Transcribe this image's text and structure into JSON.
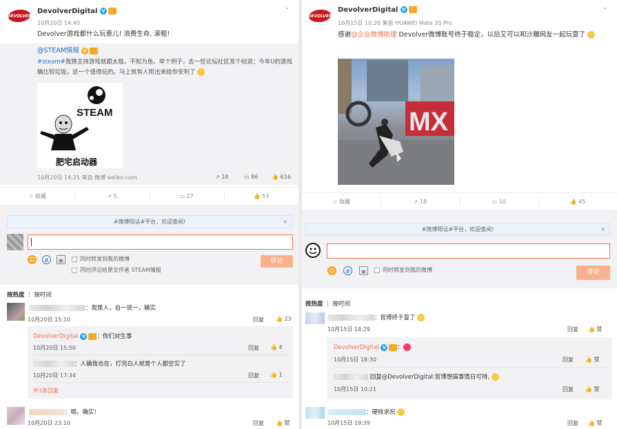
{
  "left": {
    "post": {
      "logo_text": "DEVOLVER",
      "username": "DevolverDigital",
      "time": "10月20日 14:40",
      "text": "Devolver游戏都什么玩意儿! 浪费生命, 滚粗!",
      "quote": {
        "username": "@STEAM情报",
        "hashtag": "#steam#",
        "text": "我猜主持游戏就跟太极，不知为鱼。举个例子，去一些论坛社区发个帖说：今年U的游戏确比较垃圾，这一个值得玩的。马上就有人附出来给你安利了",
        "image_caption": "肥宅启动器",
        "image_logo": "STEAM",
        "meta": "10月20日 14:25 来自 微博 weibo.com",
        "share": "18",
        "comments": "86",
        "likes": "616"
      }
    },
    "actions": {
      "fav": "收藏",
      "share": "5",
      "comments": "27",
      "likes": "53"
    },
    "comment_area": {
      "tip": "#微博阳话#平台，欢迎查阅!",
      "close": "×",
      "check1": "同时转发到我的微博",
      "check2": "同时评论给原文作者 STEAM情报",
      "submit": "评论"
    },
    "sort": {
      "hot": "按热度",
      "time": "按时间"
    },
    "comments": [
      {
        "text": "：我是人，自一说一，确实",
        "time": "10月20日 15:10",
        "reply": "回复",
        "likes": "23"
      },
      {
        "author": "DevolverDigital",
        "text": "：你们对生事",
        "time": "10月20日 15:50",
        "reply": "回复",
        "likes": "4"
      },
      {
        "text": "：人确我也在，打完白人就是个人都空实了",
        "time": "10月20日 17:34",
        "reply": "回复",
        "likes": "1"
      },
      {
        "more": "共3条回复"
      },
      {
        "text": "：嗯。确实!",
        "time": "10月20日 23:10",
        "reply": "回复",
        "likes": "赞"
      }
    ]
  },
  "right": {
    "post": {
      "logo_text": "DEVOLVER",
      "username": "DevolverDigital",
      "time": "10月15日 10:26 来自 HUAWEI Mate 20 Pro",
      "text_a": "感谢",
      "mention": "@企业微博助理",
      "text_b": " Devolver微博账号终于稳定，以后又可以和沙雕网友一起玩耍了",
      "video_sign": "MX"
    },
    "actions": {
      "fav": "收藏",
      "share": "18",
      "comments": "10",
      "likes": "45"
    },
    "comment_area": {
      "tip": "#微博阳话#平台，欢迎查阅!",
      "close": "×",
      "check1": "同时转发到我的微博",
      "submit": "评论"
    },
    "sort": {
      "hot": "按热度",
      "time": "按时间"
    },
    "comments": [
      {
        "text": "：官博终于复了",
        "time": "10月15日 18:29",
        "reply": "回复",
        "likes": "赞"
      },
      {
        "author": "DevolverDigital",
        "text": "：",
        "time": "10月15日 18:30",
        "reply": "回复",
        "likes": "赞"
      },
      {
        "text": "回复@DevolverDigital:官博想搞事情日可待,",
        "time": "10月15日 10:21",
        "reply": "回复",
        "likes": "赞"
      },
      {
        "text": "：硬核求祝",
        "time": "10月15日 19:39",
        "reply": "回复",
        "likes": "赞"
      }
    ]
  }
}
